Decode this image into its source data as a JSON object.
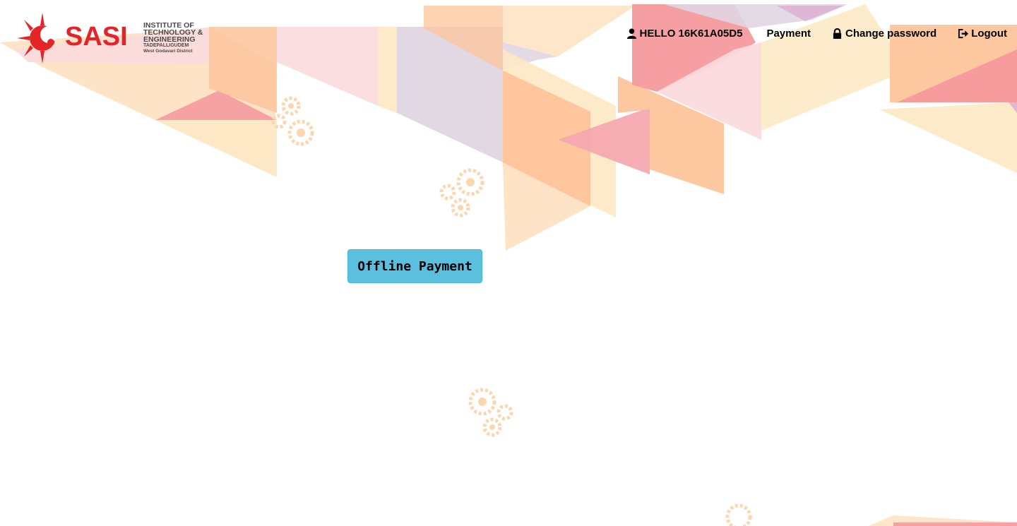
{
  "logo": {
    "brand": "SASI",
    "line1": "INSTITUTE OF",
    "line2": "TECHNOLOGY &",
    "line3": "ENGINEERING",
    "line4": "TADEPALLIGUDEM",
    "line5": "West Godavari District",
    "color": "#e42528"
  },
  "nav": {
    "greeting": "HELLO 16K61A05D5",
    "greeting_icon": "user-icon",
    "payment": "Payment",
    "change_password": "Change password",
    "change_password_icon": "lock-icon",
    "logout": "Logout",
    "logout_icon": "sign-out-icon"
  },
  "main": {
    "offline_payment_label": "Offline Payment",
    "button_color": "#5bc0de"
  },
  "colors": {
    "peach": "#fdc49b",
    "light_peach": "#fde3c4",
    "pink": "#f59a9d",
    "light_pink": "#fbdadd",
    "lavender": "#e0d6e2",
    "cream": "#fdebc8",
    "gear": "#fbd7b0"
  }
}
